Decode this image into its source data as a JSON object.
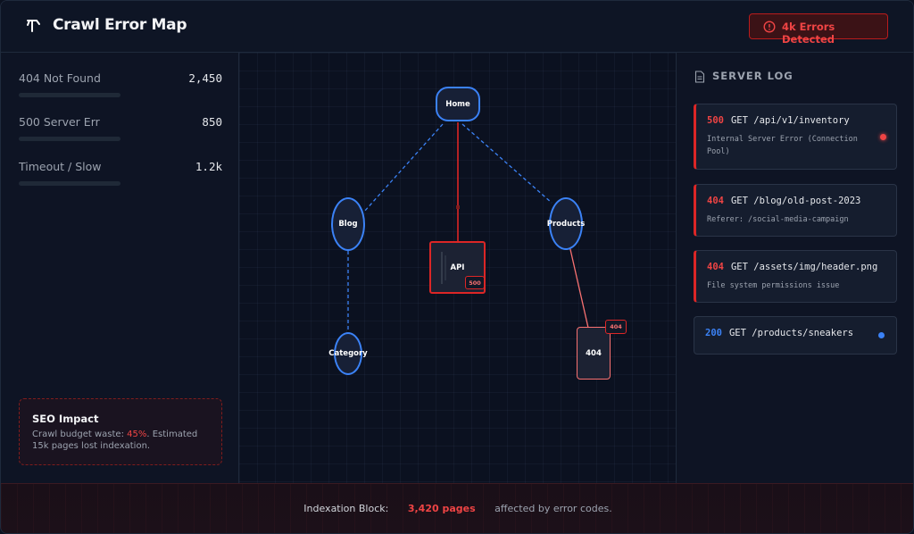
{
  "header": {
    "title": "Crawl Error Map",
    "logo_icon": "broom-icon",
    "alert": {
      "icon": "alert-circle-icon",
      "label": "4k Errors Detected",
      "color": "#ef4444"
    }
  },
  "metrics": [
    {
      "label": "404 Not Found",
      "value": "2,450"
    },
    {
      "label": "500 Server Err",
      "value": "850"
    },
    {
      "label": "Timeout / Slow",
      "value": "1.2k"
    }
  ],
  "seo_impact": {
    "title": "SEO Impact",
    "text_before": "Crawl budget waste: ",
    "highlight": "45%",
    "text_after": ". Estimated 15k pages lost indexation."
  },
  "site_map": {
    "nodes": {
      "home": {
        "label": "Home",
        "status": "ok"
      },
      "blog": {
        "label": "Blog",
        "status": "ok"
      },
      "api": {
        "label": "API",
        "status": "error",
        "code": "500"
      },
      "products": {
        "label": "Products",
        "status": "ok"
      },
      "category": {
        "label": "Category",
        "status": "ok"
      },
      "missing": {
        "label": "404",
        "status": "error",
        "code": "404"
      }
    },
    "colors": {
      "ok": "#3b82f6",
      "error": "#dc2626",
      "soft_error": "#f87171"
    }
  },
  "server_log": {
    "title": "SERVER LOG",
    "icon": "document-icon",
    "entries": [
      {
        "code": "500",
        "request": "GET /api/v1/inventory",
        "detail": "Internal Server Error (Connection Pool)",
        "status": "error"
      },
      {
        "code": "404",
        "request": "GET /blog/old-post-2023",
        "detail": "Referer: /social-media-campaign",
        "status": "error"
      },
      {
        "code": "404",
        "request": "GET /assets/img/header.png",
        "detail": "File system permissions issue",
        "status": "error"
      },
      {
        "code": "200",
        "request": "GET /products/sneakers",
        "detail": "",
        "status": "ok"
      }
    ]
  },
  "footer": {
    "label": "Indexation Block:",
    "count": "3,420 pages",
    "suffix": "affected by error codes."
  }
}
